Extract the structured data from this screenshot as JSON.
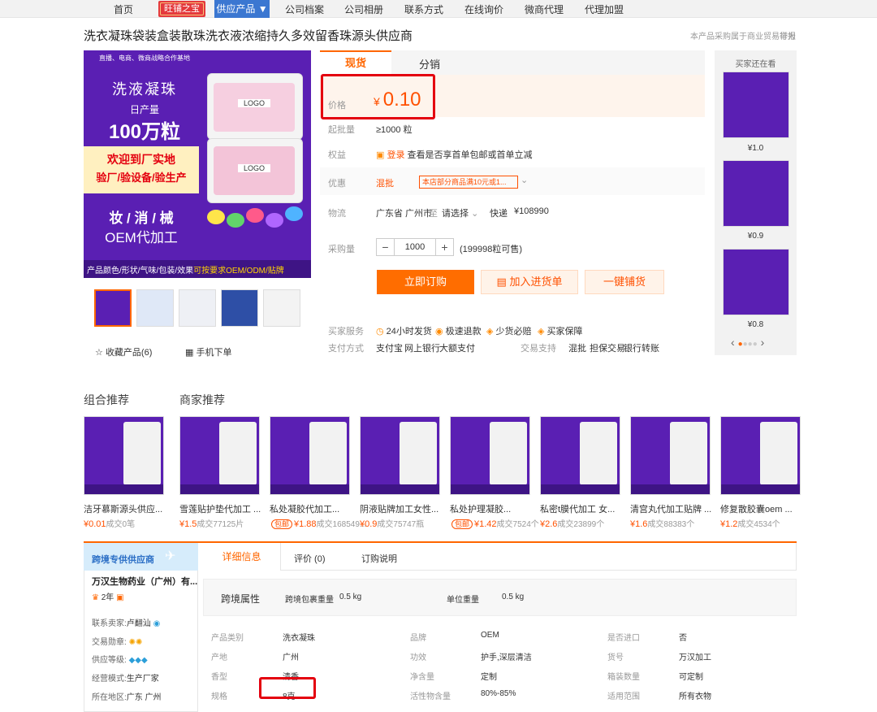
{
  "nav": {
    "home": "首页",
    "badge": "旺铺之宝",
    "supply": "供应产品 ▼",
    "items": [
      "公司档案",
      "公司相册",
      "联系方式",
      "在线询价",
      "微商代理",
      "代理加盟"
    ]
  },
  "title": "洗衣凝珠袋装盒装散珠洗衣液浓缩持久多效留香珠源头供应商",
  "title_note": "本产品采购属于商业贸易行为",
  "report": "举报",
  "main_image": {
    "top_banner": "直播、电商、微商战略合作基地",
    "product": "洗液凝珠",
    "daily_label": "日产量",
    "daily_value": "100万粒",
    "welcome_1": "欢迎到厂实地",
    "welcome_2": "验厂/验设备/验生产",
    "service": "妆 / 消 / 械",
    "oem": "OEM代加工",
    "logo": "LOGO",
    "bottom_white": "产品颜色/形状/气味/包装/效果",
    "bottom_yellow": "可按要求OEM/ODM/贴牌"
  },
  "favorites": "收藏产品(6)",
  "mobile_order": "手机下单",
  "tabs": {
    "active": "现货",
    "other": "分销"
  },
  "price": {
    "label": "价格",
    "currency": "¥",
    "value": "0.10"
  },
  "moq": {
    "label": "起批量",
    "value": "≥1000 粒"
  },
  "rights": {
    "label": "权益",
    "login": "登录",
    "text": "查看是否享首单包邮或首单立减"
  },
  "promo": {
    "label": "优惠",
    "type": "混批",
    "tag": "本店部分商品满10元或1..."
  },
  "logistics": {
    "label": "物流",
    "from": "广东省 广州市",
    "to_label": "至",
    "to": "请选择",
    "method": "快递",
    "fee": "¥108990"
  },
  "quantity": {
    "label": "采购量",
    "value": "1000",
    "stock": "(199998粒可售)"
  },
  "buttons": {
    "buy": "立即订购",
    "cart": "加入进货单",
    "dist": "一键铺货"
  },
  "services": {
    "label": "买家服务",
    "items": [
      "24小时发货",
      "极速退款",
      "少货必赔",
      "买家保障"
    ]
  },
  "payment": {
    "label": "支付方式",
    "items": [
      "支付宝",
      "网上银行",
      "大额支付"
    ],
    "trade_label": "交易支持",
    "trade_items": [
      "混批",
      "担保交易",
      "银行转账"
    ]
  },
  "side": {
    "title": "买家还在看",
    "items": [
      {
        "price": "¥1.0"
      },
      {
        "price": "¥0.9"
      },
      {
        "price": "¥0.8"
      }
    ]
  },
  "sections": {
    "combo": "组合推荐",
    "merchant": "商家推荐"
  },
  "recommend": [
    {
      "name": "洁牙慕斯源头供应...",
      "price": "¥0.01",
      "deal": "成交0笔"
    },
    {
      "name": "雪莲贴护垫代加工 ...",
      "price": "¥1.5",
      "deal": "成交77125片"
    },
    {
      "name": "私处凝胶代加工...",
      "price": "¥1.88",
      "deal": "成交168549..."
    },
    {
      "name": "阴液贴牌加工女性...",
      "price": "¥0.9",
      "deal": "成交75747瓶"
    },
    {
      "name": "私处护理凝胶...",
      "price": "¥1.42",
      "deal": "成交7524个"
    },
    {
      "name": "私密t膜代加工 女...",
      "price": "¥2.6",
      "deal": "成交23899个"
    },
    {
      "name": "清宫丸代加工贴牌 ...",
      "price": "¥1.6",
      "deal": "成交88383个"
    },
    {
      "name": "修复散胶囊oem ...",
      "price": "¥1.2",
      "deal": "成交4534个"
    }
  ],
  "rec_tag": "包邮",
  "supplier": {
    "head": "跨境专供供应商",
    "name": "万汉生物药业（广州）有...",
    "years": "2年",
    "contact_label": "联系卖家:",
    "contact": "卢翻汕",
    "medal_label": "交易勋章:",
    "level_label": "供应等级:",
    "mode_label": "经营模式:",
    "mode": "生产厂家",
    "region_label": "所在地区:",
    "region": "广东 广州"
  },
  "detail_tabs": [
    "详细信息",
    "评价 (0)",
    "订购说明"
  ],
  "crossborder": {
    "title": "跨境属性",
    "weight_label": "跨境包裹重量",
    "weight": "0.5 kg",
    "unit_label": "单位重量",
    "unit": "0.5 kg"
  },
  "attrs": [
    [
      {
        "k": "产品类别",
        "v": "洗衣凝珠"
      },
      {
        "k": "品牌",
        "v": "OEM"
      },
      {
        "k": "是否进口",
        "v": "否"
      }
    ],
    [
      {
        "k": "产地",
        "v": "广州"
      },
      {
        "k": "功效",
        "v": "护手,深层清洁"
      },
      {
        "k": "货号",
        "v": "万汉加工"
      }
    ],
    [
      {
        "k": "香型",
        "v": "清香"
      },
      {
        "k": "净含量",
        "v": "定制"
      },
      {
        "k": "箱装数量",
        "v": "可定制"
      }
    ],
    [
      {
        "k": "规格",
        "v": "8克"
      },
      {
        "k": "活性物含量",
        "v": "80%-85%"
      },
      {
        "k": "适用范围",
        "v": "所有衣物"
      }
    ]
  ],
  "colors": {
    "accent": "#ff6600",
    "price": "#ff5000",
    "purple": "#5a1fb3",
    "highlight": "#e4000f"
  }
}
